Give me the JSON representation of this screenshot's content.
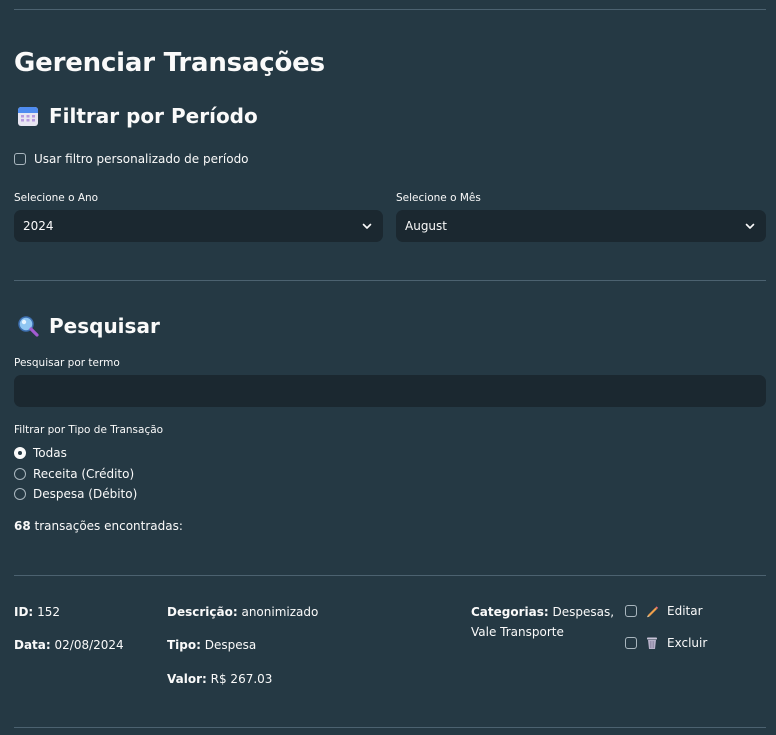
{
  "page": {
    "title": "Gerenciar Transações",
    "filter_section": {
      "title": "Filtrar por Período",
      "custom_period_label": "Usar filtro personalizado de período",
      "year_label": "Selecione o Ano",
      "year_value": "2024",
      "month_label": "Selecione o Mês",
      "month_value": "August"
    },
    "search_section": {
      "title": "Pesquisar",
      "search_label": "Pesquisar por termo",
      "search_value": "",
      "type_label": "Filtrar por Tipo de Transação",
      "type_options": [
        "Todas",
        "Receita (Crédito)",
        "Despesa (Débito)"
      ],
      "type_selected": "Todas",
      "count_number": "68",
      "count_text": "transações encontradas:"
    },
    "transaction": {
      "id_label": "ID:",
      "id_value": "152",
      "date_label": "Data:",
      "date_value": "02/08/2024",
      "desc_label": "Descrição:",
      "desc_value": "anonimizado",
      "type_label": "Tipo:",
      "type_value": "Despesa",
      "value_label": "Valor:",
      "value_value": "R$ 267.03",
      "categories_label": "Categorias:",
      "categories_line1": "Despesas,",
      "categories_line2": "Vale Transporte",
      "edit_label": "Editar",
      "delete_label": "Excluir"
    }
  },
  "colors": {
    "background": "#253944",
    "input_bg": "#1b2830",
    "divider": "#4c6270",
    "text": "#fafafa"
  },
  "icons": {
    "filter_section": "calendar-icon",
    "search_section": "magnifier-icon",
    "edit": "pencil-icon",
    "delete": "wastebasket-icon"
  }
}
